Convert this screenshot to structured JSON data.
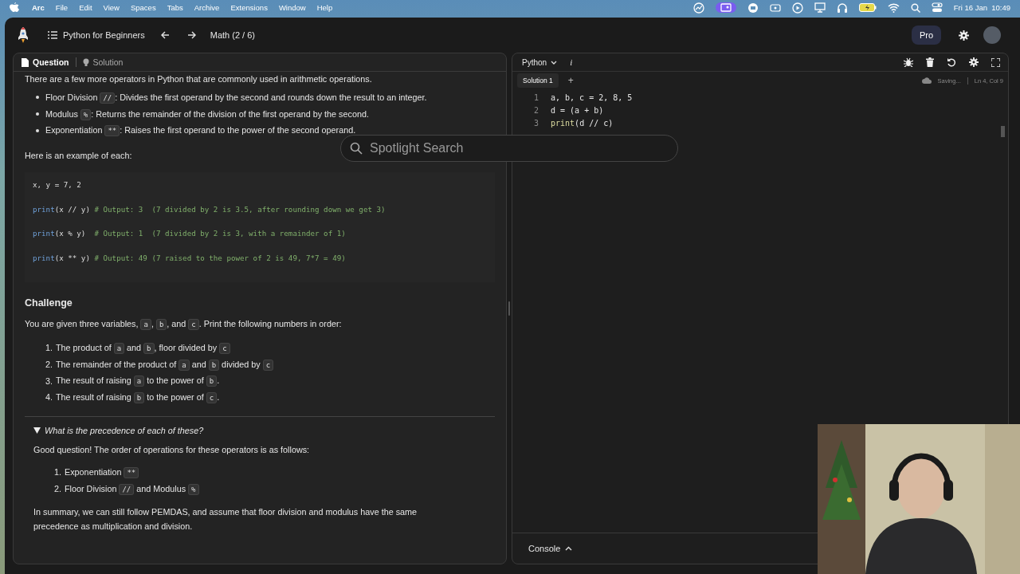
{
  "menubar": {
    "items": [
      {
        "label": "Arc",
        "selected": true
      },
      {
        "label": "File",
        "selected": false
      },
      {
        "label": "Edit",
        "selected": false
      },
      {
        "label": "View",
        "selected": false
      },
      {
        "label": "Spaces",
        "selected": false
      },
      {
        "label": "Tabs",
        "selected": false
      },
      {
        "label": "Archive",
        "selected": false
      },
      {
        "label": "Extensions",
        "selected": false
      },
      {
        "label": "Window",
        "selected": false
      },
      {
        "label": "Help",
        "selected": false
      }
    ],
    "clock": "Fri 16 Jan  10:49"
  },
  "header": {
    "course": "Python for Beginners",
    "lesson": "Math (2 / 6)",
    "plan": "Pro"
  },
  "tabs": [
    {
      "label": "Question",
      "selected": true
    },
    {
      "label": "Solution",
      "selected": false
    }
  ],
  "question": {
    "intro": "There are a few more operators in Python that are commonly used in arithmetic operations.",
    "operators": [
      [
        {
          "text": "Floor Division ",
          "code": false
        },
        {
          "text": "//",
          "code": true
        },
        {
          "text": ": Divides the first operand by the second and rounds down the result to an integer.",
          "code": false
        }
      ],
      [
        {
          "text": "Modulus ",
          "code": false
        },
        {
          "text": "%",
          "code": true
        },
        {
          "text": ": Returns the remainder of the division of the first operand by the second.",
          "code": false
        }
      ],
      [
        {
          "text": "Exponentiation ",
          "code": false
        },
        {
          "text": "**",
          "code": true
        },
        {
          "text": ": Raises the first operand to the power of the second operand.",
          "code": false
        }
      ]
    ],
    "example_label": "Here is an example of each:",
    "code": [
      [
        {
          "text": "x, y = 7, 2",
          "kind": "plain"
        }
      ],
      [
        {
          "text": "print",
          "kind": "builtin"
        },
        {
          "text": "(x // y) ",
          "kind": "plain"
        },
        {
          "text": "# Output: 3  (7 divided by 2 is 3.5, after rounding down we get 3)",
          "kind": "comment"
        }
      ],
      [
        {
          "text": "print",
          "kind": "builtin"
        },
        {
          "text": "(x % y)  ",
          "kind": "plain"
        },
        {
          "text": "# Output: 1  (7 divided by 2 is 3, with a remainder of 1)",
          "kind": "comment"
        }
      ],
      [
        {
          "text": "print",
          "kind": "builtin"
        },
        {
          "text": "(x ** y) ",
          "kind": "plain"
        },
        {
          "text": "# Output: 49 (7 raised to the power of 2 is 49, 7*7 = 49)",
          "kind": "comment"
        }
      ]
    ],
    "challenge_title": "Challenge",
    "challenge_intro": [
      {
        "text": "You are given three variables, ",
        "code": false
      },
      {
        "text": "a",
        "code": true
      },
      {
        "text": ", ",
        "code": false
      },
      {
        "text": "b",
        "code": true
      },
      {
        "text": ", and ",
        "code": false
      },
      {
        "text": "c",
        "code": true
      },
      {
        "text": ". Print the following numbers in order:",
        "code": false
      }
    ],
    "steps": [
      {
        "number": "1.",
        "parts": [
          {
            "text": "The product of ",
            "code": false
          },
          {
            "text": "a",
            "code": true
          },
          {
            "text": " and ",
            "code": false
          },
          {
            "text": "b",
            "code": true
          },
          {
            "text": ", floor divided by ",
            "code": false
          },
          {
            "text": "c",
            "code": true
          }
        ]
      },
      {
        "number": "2.",
        "parts": [
          {
            "text": "The remainder of the product of ",
            "code": false
          },
          {
            "text": "a",
            "code": true
          },
          {
            "text": " and ",
            "code": false
          },
          {
            "text": "b",
            "code": true
          },
          {
            "text": " divided by ",
            "code": false
          },
          {
            "text": "c",
            "code": true
          }
        ]
      },
      {
        "number": "3.",
        "parts": [
          {
            "text": "The result of raising ",
            "code": false
          },
          {
            "text": "a",
            "code": true
          },
          {
            "text": " to the power of ",
            "code": false
          },
          {
            "text": "b",
            "code": true
          },
          {
            "text": ".",
            "code": false
          }
        ]
      },
      {
        "number": "4.",
        "parts": [
          {
            "text": "The result of raising ",
            "code": false
          },
          {
            "text": "b",
            "code": true
          },
          {
            "text": " to the power of ",
            "code": false
          },
          {
            "text": "c",
            "code": true
          },
          {
            "text": ".",
            "code": false
          }
        ]
      }
    ],
    "details": {
      "summary": "What is the precedence of each of these?",
      "expanded": true,
      "intro": "Good question! The order of operations for these operators is as follows:",
      "order": [
        {
          "number": "1.",
          "parts": [
            {
              "text": "Exponentiation ",
              "code": false
            },
            {
              "text": "**",
              "code": true
            }
          ]
        },
        {
          "number": "2.",
          "parts": [
            {
              "text": "Floor Division ",
              "code": false
            },
            {
              "text": "//",
              "code": true
            },
            {
              "text": " and Modulus ",
              "code": false
            },
            {
              "text": "%",
              "code": true
            }
          ]
        }
      ],
      "conclusion": "In summary, we can still follow PEMDAS, and assume that floor division and modulus have the same precedence as multiplication and division."
    }
  },
  "editor": {
    "language": "Python",
    "info": "i",
    "tabs": [
      {
        "label": "Solution 1",
        "selected": true
      }
    ],
    "add": "+",
    "status": "Saving...",
    "cursor": "Ln 4, Col 9",
    "lines": [
      {
        "number": "1",
        "tokens": [
          {
            "text": "a, b, c = 2, 8, 5",
            "kind": "plain"
          }
        ]
      },
      {
        "number": "2",
        "tokens": [
          {
            "text": "d = (a + b)",
            "kind": "plain"
          }
        ]
      },
      {
        "number": "3",
        "tokens": [
          {
            "text": "print",
            "kind": "builtin"
          },
          {
            "text": "(d // c)",
            "kind": "plain"
          }
        ]
      }
    ]
  },
  "spotlight": {
    "placeholder": "Spotlight Search"
  },
  "console": {
    "label": "Console",
    "expanded": false
  }
}
